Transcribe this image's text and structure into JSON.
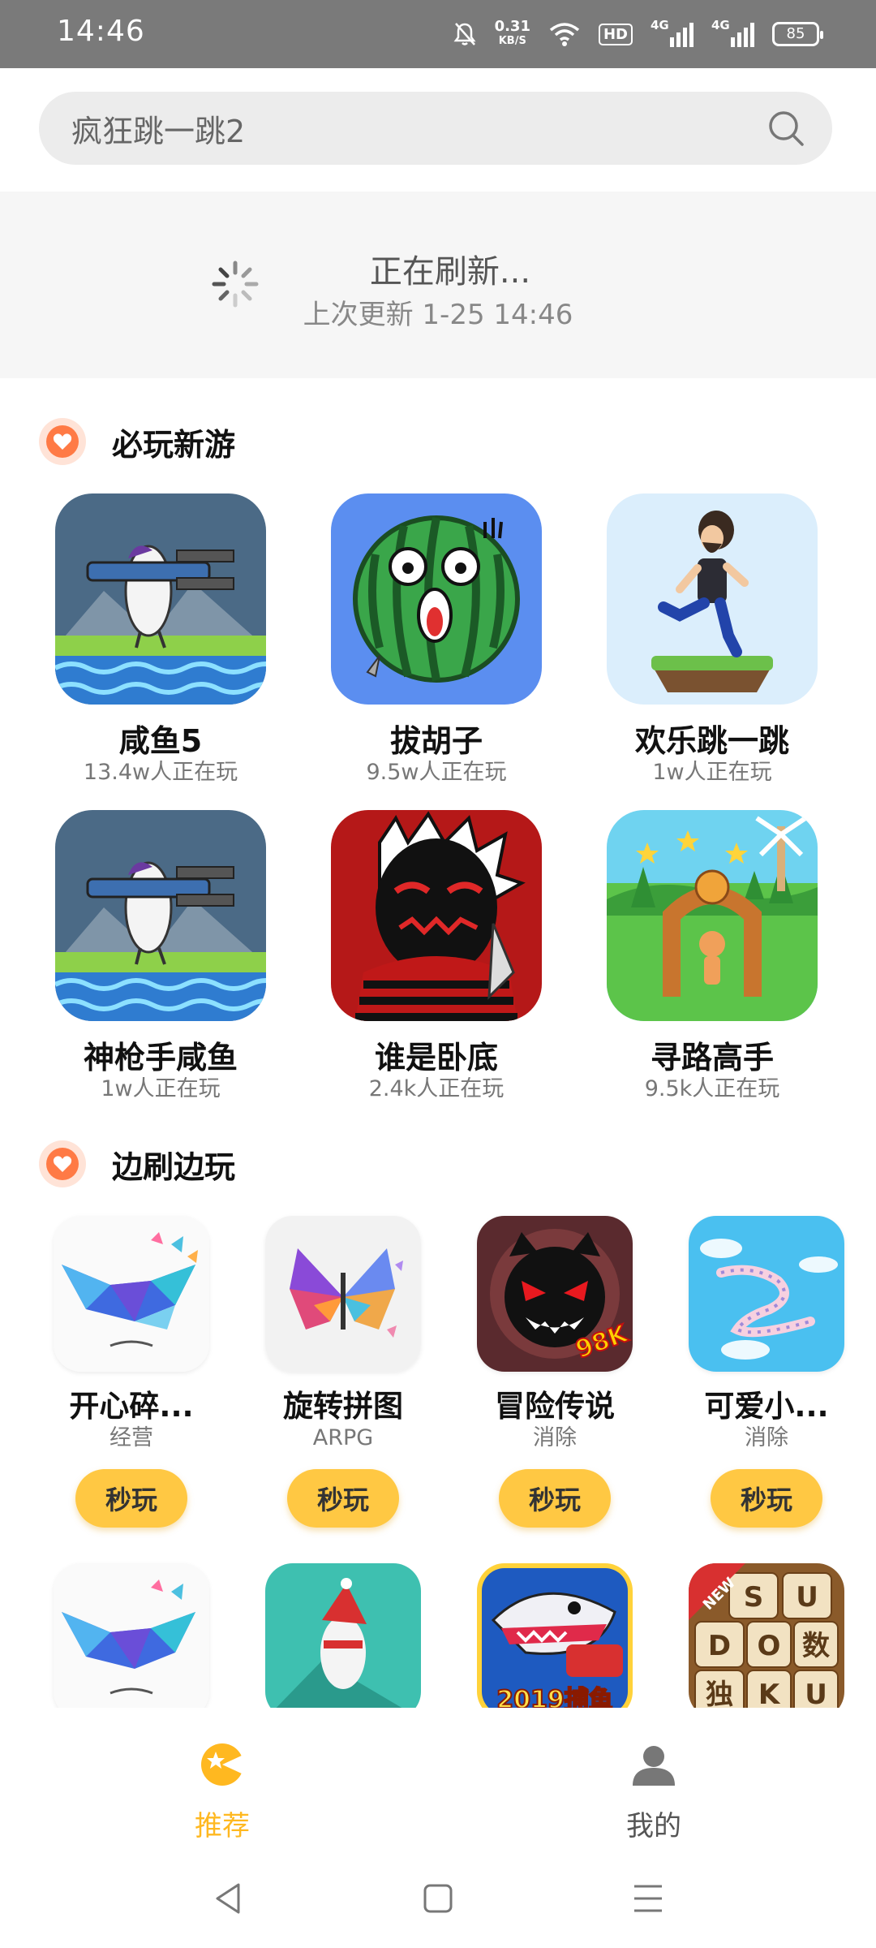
{
  "status_bar": {
    "time": "14:46",
    "net_speed_value": "0.31",
    "net_speed_unit": "KB/S",
    "hd_label": "HD",
    "signal1_label": "4G",
    "signal2_label": "4G",
    "battery": "85"
  },
  "search": {
    "value": "疯狂跳一跳2"
  },
  "refresh": {
    "title": "正在刷新...",
    "last_update": "上次更新 1-25 14:46"
  },
  "section1": {
    "title": "必玩新游",
    "games": [
      {
        "name": "咸鱼5",
        "players": "13.4w人正在玩"
      },
      {
        "name": "拔胡子",
        "players": "9.5w人正在玩"
      },
      {
        "name": "欢乐跳一跳",
        "players": "1w人正在玩"
      },
      {
        "name": "神枪手咸鱼",
        "players": "1w人正在玩"
      },
      {
        "name": "谁是卧底",
        "players": "2.4k人正在玩"
      },
      {
        "name": "寻路高手",
        "players": "9.5k人正在玩"
      }
    ]
  },
  "section2": {
    "title": "边刷边玩",
    "play_label": "秒玩",
    "games": [
      {
        "name": "开心碎...",
        "genre": "经营"
      },
      {
        "name": "旋转拼图",
        "genre": "ARPG"
      },
      {
        "name": "冒险传说",
        "genre": "消除"
      },
      {
        "name": "可爱小...",
        "genre": "消除"
      }
    ],
    "icon_texts": {
      "badge_98k": "98K",
      "fish_2019": "2019捕鱼",
      "new_ribbon": "NEW",
      "sudoku": [
        "S",
        "U",
        "D",
        "O",
        "数",
        "独",
        "K",
        "U"
      ]
    }
  },
  "bottom_nav": {
    "items": [
      {
        "label": "推荐",
        "active": true
      },
      {
        "label": "我的",
        "active": false
      }
    ],
    "active_color": "#ffb820",
    "inactive_color": "#555555"
  }
}
